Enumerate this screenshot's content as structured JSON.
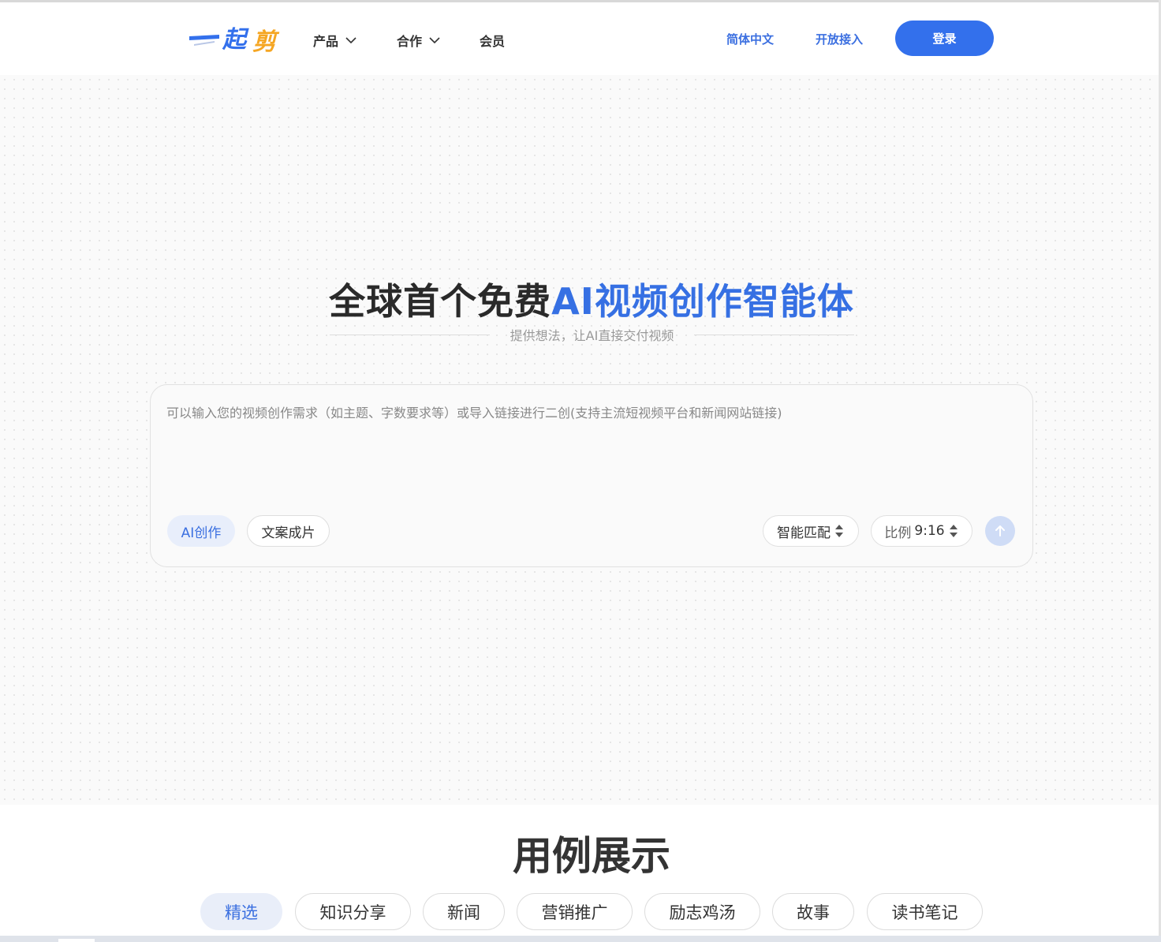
{
  "header": {
    "logo_text": "一起剪",
    "nav": [
      {
        "label": "产品",
        "has_dropdown": true
      },
      {
        "label": "合作",
        "has_dropdown": true
      },
      {
        "label": "会员",
        "has_dropdown": false
      }
    ],
    "language": "简体中文",
    "open_access": "开放接入",
    "login": "登录"
  },
  "hero": {
    "title_plain": "全球首个免费",
    "title_accent": "AI视频创作智能体",
    "subtitle": "提供想法，让AI直接交付视频"
  },
  "composer": {
    "placeholder": "可以输入您的视频创作需求（如主题、字数要求等）或导入链接进行二创(支持主流短视频平台和新闻网站链接)",
    "value": "",
    "modes": [
      {
        "label": "AI创作",
        "selected": true
      },
      {
        "label": "文案成片",
        "selected": false
      }
    ],
    "match_select": "智能匹配",
    "ratio_label": "比例",
    "ratio_value": "9:16",
    "send_icon": "arrow-up-icon"
  },
  "examples": {
    "title": "用例展示",
    "tabs": [
      {
        "label": "精选",
        "active": true
      },
      {
        "label": "知识分享",
        "active": false
      },
      {
        "label": "新闻",
        "active": false
      },
      {
        "label": "营销推广",
        "active": false
      },
      {
        "label": "励志鸡汤",
        "active": false
      },
      {
        "label": "故事",
        "active": false
      },
      {
        "label": "读书笔记",
        "active": false
      }
    ]
  },
  "colors": {
    "brand_blue": "#3370ec",
    "accent_text": "#3670e3",
    "logo_orange": "#f5a623"
  }
}
